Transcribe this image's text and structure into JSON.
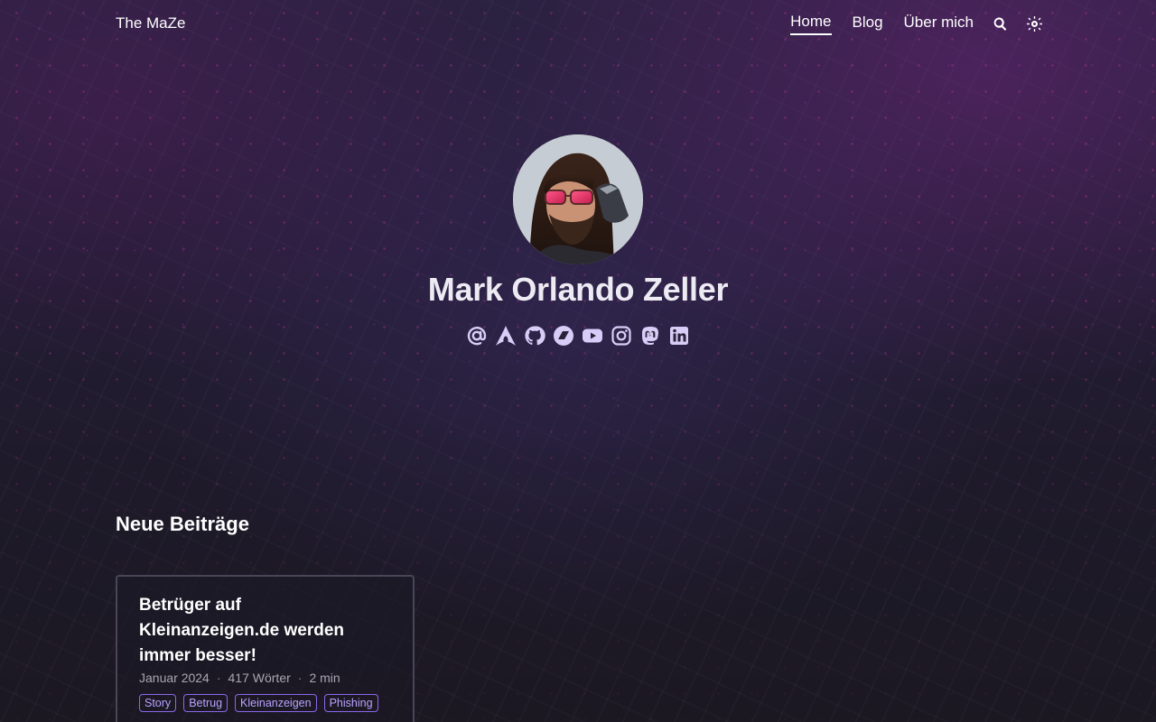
{
  "header": {
    "site_title": "The MaZe",
    "nav": [
      {
        "label": "Home",
        "active": true
      },
      {
        "label": "Blog",
        "active": false
      },
      {
        "label": "Über mich",
        "active": false
      }
    ],
    "icons": [
      "search-icon",
      "theme-toggle-icon"
    ]
  },
  "profile": {
    "name": "Mark Orlando Zeller",
    "socials": [
      "email",
      "arch-linux",
      "github",
      "bluesky",
      "youtube",
      "instagram",
      "mastodon",
      "linkedin"
    ]
  },
  "section": {
    "title": "Neue Beiträge"
  },
  "post": {
    "title": "Betrüger auf Kleinanzeigen.de werden immer besser!",
    "date": "Januar 2024",
    "words": "417 Wörter",
    "reading_time": "2 min",
    "separator": "·",
    "tags": [
      "Story",
      "Betrug",
      "Kleinanzeigen",
      "Phishing"
    ]
  },
  "colors": {
    "accent": "#8b68ea",
    "tag_text": "#b9a3ff",
    "social_icon": "#d8cdf7",
    "background": "#1c1826"
  }
}
